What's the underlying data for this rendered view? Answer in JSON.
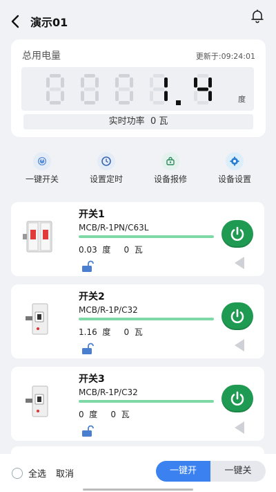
{
  "header": {
    "title": "演示01"
  },
  "meter": {
    "label": "总用电量",
    "updated": "更新于:09:24:01",
    "reading": "0001.41",
    "unit": "度",
    "power_label": "实时功率",
    "power_value": "0 瓦"
  },
  "actions": [
    {
      "label": "一键开关",
      "icon": "power-icon"
    },
    {
      "label": "设置定时",
      "icon": "timer-icon"
    },
    {
      "label": "设备报修",
      "icon": "repair-icon"
    },
    {
      "label": "设备设置",
      "icon": "settings-icon"
    }
  ],
  "switches": [
    {
      "name": "开关1",
      "model": "MCB/R-1PN/C63L",
      "energy": "0.03",
      "energy_unit": "度",
      "power": "0",
      "power_unit": "瓦",
      "on": true
    },
    {
      "name": "开关2",
      "model": "MCB/R-1P/C32",
      "energy": "1.16",
      "energy_unit": "度",
      "power": "0",
      "power_unit": "瓦",
      "on": true
    },
    {
      "name": "开关3",
      "model": "MCB/R-1P/C32",
      "energy": "0",
      "energy_unit": "度",
      "power": "0",
      "power_unit": "瓦",
      "on": true
    }
  ],
  "bottom": {
    "select_all": "全选",
    "cancel": "取消",
    "all_on": "一键开",
    "all_off": "一键关"
  },
  "colors": {
    "accent": "#3b82f0",
    "on": "#1f9a52",
    "line": "#7fd9a6"
  }
}
